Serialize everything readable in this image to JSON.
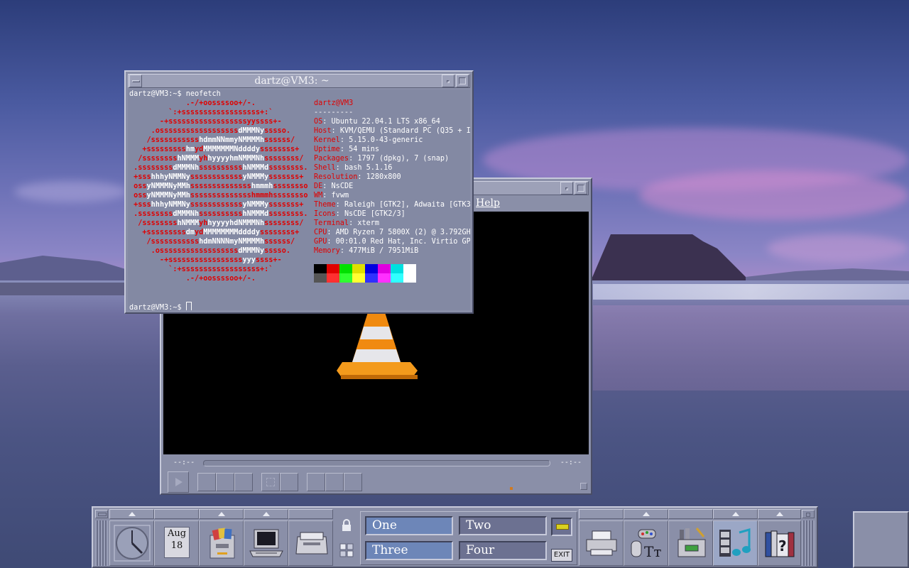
{
  "terminal": {
    "title": "dartz@VM3: ~",
    "prompt_cmd": "dartz@VM3:~$ neofetch",
    "prompt_end": "dartz@VM3:~$ ",
    "user_host": "dartz@VM3",
    "separator": "---------",
    "info": [
      {
        "key": "OS",
        "val": ": Ubuntu 22.04.1 LTS x86_64"
      },
      {
        "key": "Host",
        "val": ": KVM/QEMU (Standard PC (Q35 + I"
      },
      {
        "key": "Kernel",
        "val": ": 5.15.0-43-generic"
      },
      {
        "key": "Uptime",
        "val": ": 54 mins"
      },
      {
        "key": "Packages",
        "val": ": 1797 (dpkg), 7 (snap)"
      },
      {
        "key": "Shell",
        "val": ": bash 5.1.16"
      },
      {
        "key": "Resolution",
        "val": ": 1280x800"
      },
      {
        "key": "DE",
        "val": ": NsCDE"
      },
      {
        "key": "WM",
        "val": ": fvwm"
      },
      {
        "key": "Theme",
        "val": ": Raleigh [GTK2], Adwaita [GTK3"
      },
      {
        "key": "Icons",
        "val": ": NsCDE [GTK2/3]"
      },
      {
        "key": "Terminal",
        "val": ": xterm"
      },
      {
        "key": "CPU",
        "val": ": AMD Ryzen 7 5800X (2) @ 3.792GH"
      },
      {
        "key": "GPU",
        "val": ": 00:01.0 Red Hat, Inc. Virtio GP"
      },
      {
        "key": "Memory",
        "val": ": 477MiB / 7951MiB"
      }
    ],
    "palette": [
      "#000000",
      "#e00000",
      "#00e000",
      "#e0e000",
      "#0000e0",
      "#e000e0",
      "#00e0e0",
      "#ffffff"
    ],
    "palette_row2": [
      "#555555",
      "#ff3030",
      "#30ff30",
      "#ffff30",
      "#3030ff",
      "#ff30ff",
      "#30ffff",
      "#ffffff"
    ]
  },
  "vlc": {
    "menu_help": "Help",
    "time_left": "--:--",
    "time_right": "--:--"
  },
  "panel": {
    "date_month": "Aug",
    "date_day": "18",
    "workspaces": [
      {
        "label": "One",
        "active": true
      },
      {
        "label": "Two",
        "active": false
      },
      {
        "label": "Three",
        "active": true
      },
      {
        "label": "Four",
        "active": false
      }
    ],
    "exit_label": "EXIT"
  }
}
